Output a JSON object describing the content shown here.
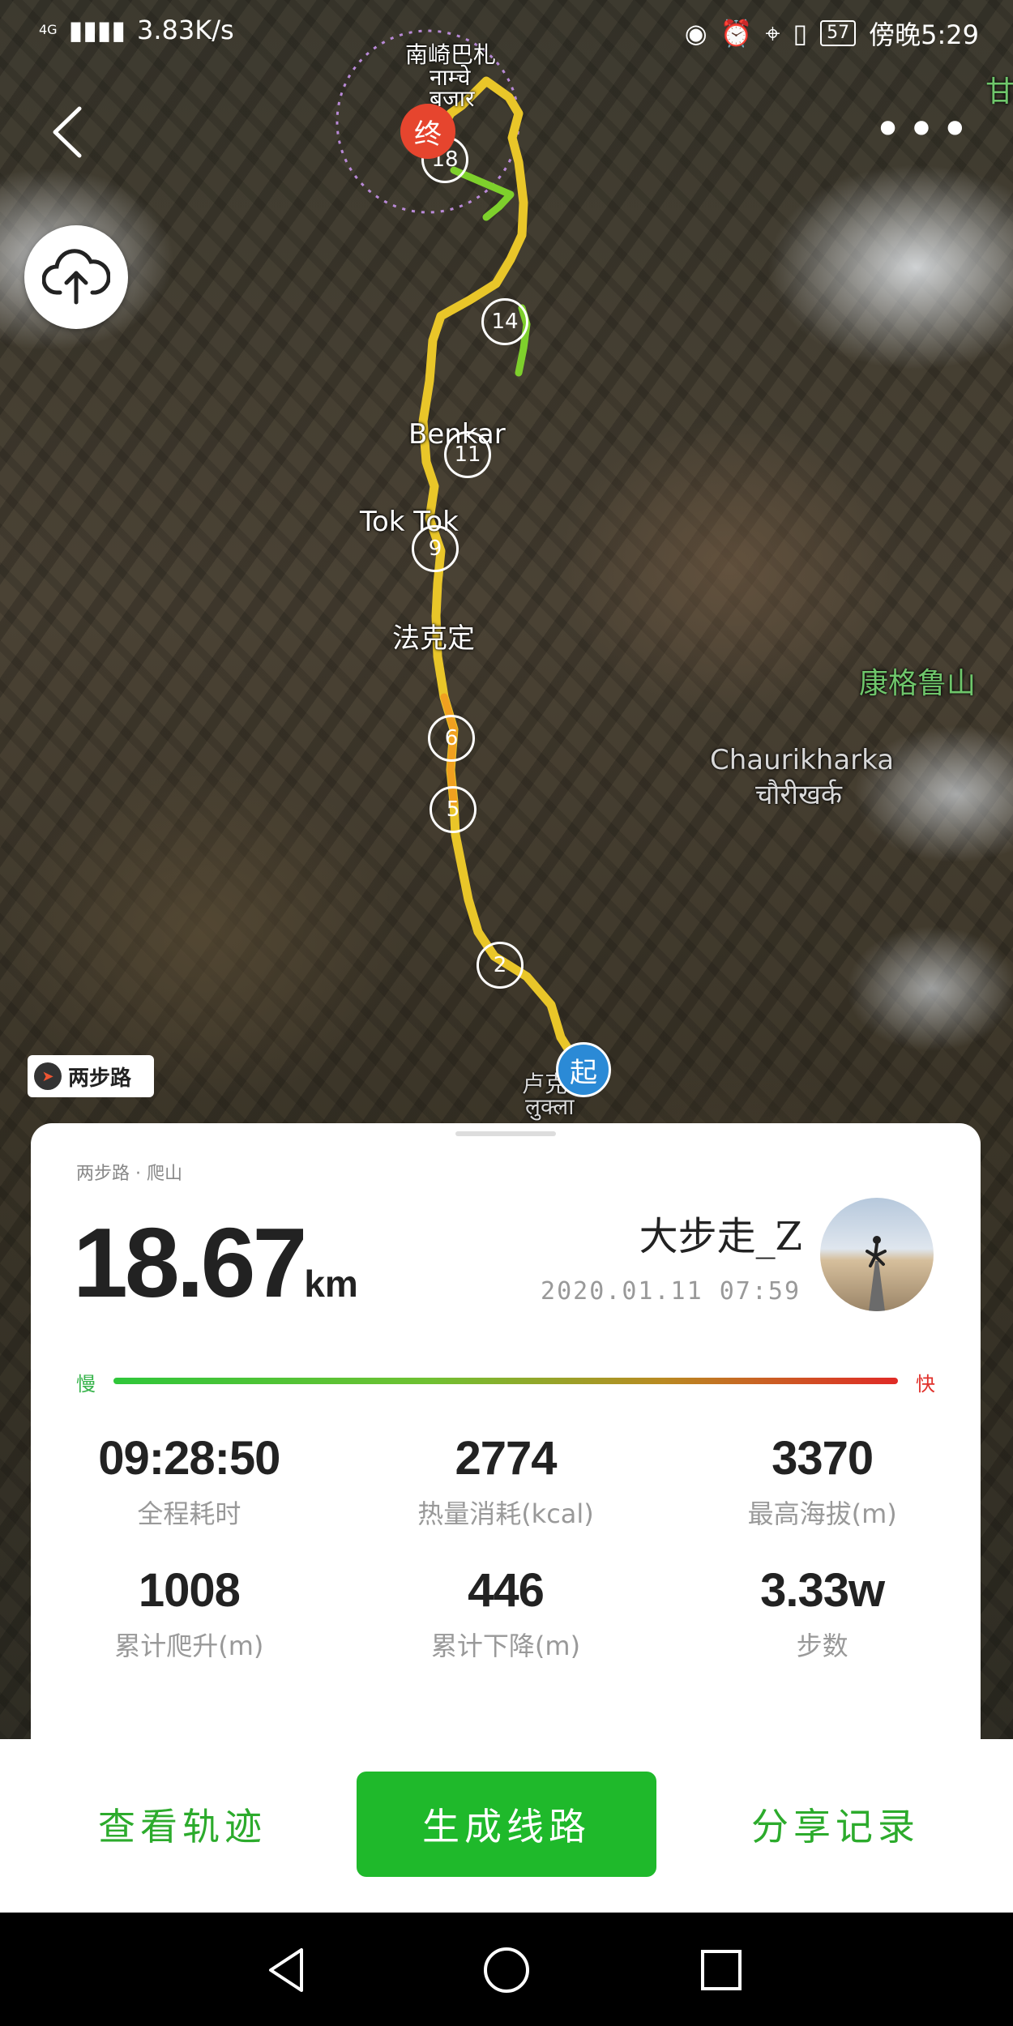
{
  "status_bar": {
    "network": "4G",
    "speed": "3.83K/s",
    "battery": "57",
    "time": "傍晚5:29"
  },
  "map": {
    "labels": {
      "namche_zh": "南崎巴札",
      "namche_np": "नाम्चे",
      "namche_bazar": "बजार",
      "benkar": "Benkar",
      "tok_tok": "Tok Tok",
      "phakding": "法克定",
      "kangri": "康格鲁山",
      "chaurikharka": "Chaurikharka",
      "chaurikharka_np": "चौरीखर्क",
      "lukla_zh": "卢克",
      "lukla_np": "लुक्ला",
      "edge_char": "甘"
    },
    "markers": [
      "18",
      "14",
      "11",
      "9",
      "6",
      "5",
      "2"
    ],
    "start_label": "起",
    "end_label": "终",
    "brand_tag": "两步路"
  },
  "card": {
    "subtitle": "两步路 · 爬山",
    "distance": "18.67",
    "distance_unit": "km",
    "username": "大步走_Z",
    "datetime": "2020.01.11 07:59",
    "slow_label": "慢",
    "fast_label": "快",
    "stats": [
      {
        "value": "09:28:50",
        "label": "全程耗时"
      },
      {
        "value": "2774",
        "label": "热量消耗(kcal)"
      },
      {
        "value": "3370",
        "label": "最高海拔(m)"
      },
      {
        "value": "1008",
        "label": "累计爬升(m)"
      },
      {
        "value": "446",
        "label": "累计下降(m)"
      },
      {
        "value": "3.33w",
        "label": "步数"
      }
    ]
  },
  "actions": {
    "view_track": "查看轨迹",
    "generate_route": "生成线路",
    "share_record": "分享记录"
  },
  "colors": {
    "accent": "#1fb92b",
    "start_marker": "#2b8ad6",
    "end_marker": "#e6452e"
  }
}
